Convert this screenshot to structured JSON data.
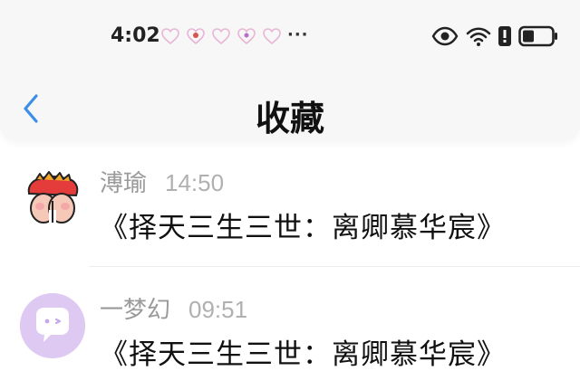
{
  "status_bar": {
    "time": "4:02",
    "notification_icons": [
      "heart-icon",
      "heart-badge-icon",
      "heart-icon",
      "heart-badge-icon",
      "heart-icon"
    ],
    "more": "···",
    "system_icons": [
      "eye-icon",
      "wifi-icon",
      "alert-icon",
      "battery-icon"
    ]
  },
  "nav": {
    "title": "收藏",
    "back_icon": "chevron-left-icon"
  },
  "favorites": [
    {
      "sender": "溥瑜",
      "time": "14:50",
      "message": "《择天三生三世：离卿慕华宸》",
      "avatar": "cartoon-avatar"
    },
    {
      "sender": "一梦幻",
      "time": "09:51",
      "message": "《择天三生三世：离卿慕华宸》",
      "avatar": "chat-bubble-avatar"
    }
  ],
  "colors": {
    "accent": "#3d8ee8",
    "avatar_purple": "#ddc9f2"
  }
}
